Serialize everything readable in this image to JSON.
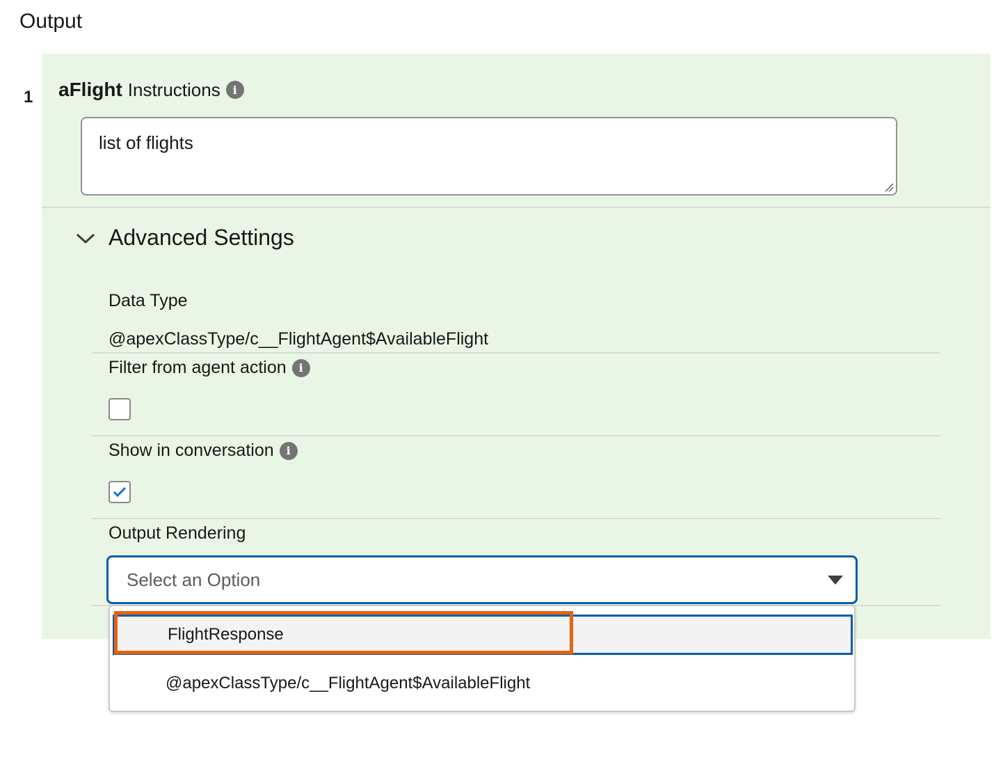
{
  "section": {
    "title": "Output"
  },
  "output_item": {
    "index": "1",
    "name": "aFlight",
    "instructions_label": "Instructions",
    "instructions_value": "list of flights"
  },
  "advanced": {
    "title": "Advanced Settings",
    "data_type_label": "Data Type",
    "data_type_value": "@apexClassType/c__FlightAgent$AvailableFlight",
    "filter_label": "Filter from agent action",
    "filter_checked": false,
    "show_label": "Show in conversation",
    "show_checked": true,
    "rendering_label": "Output Rendering",
    "rendering_placeholder": "Select an Option",
    "options": [
      "FlightResponse",
      "@apexClassType/c__FlightAgent$AvailableFlight"
    ]
  },
  "colors": {
    "panel_bg": "#eaf6e5",
    "focus_border": "#0b5cab",
    "callout_border": "#e8620f",
    "checkmark": "#0176d3"
  },
  "icons": [
    "info-icon",
    "chevron-down-icon",
    "checkmark-icon",
    "dropdown-arrow-icon",
    "resize-grip-icon"
  ]
}
